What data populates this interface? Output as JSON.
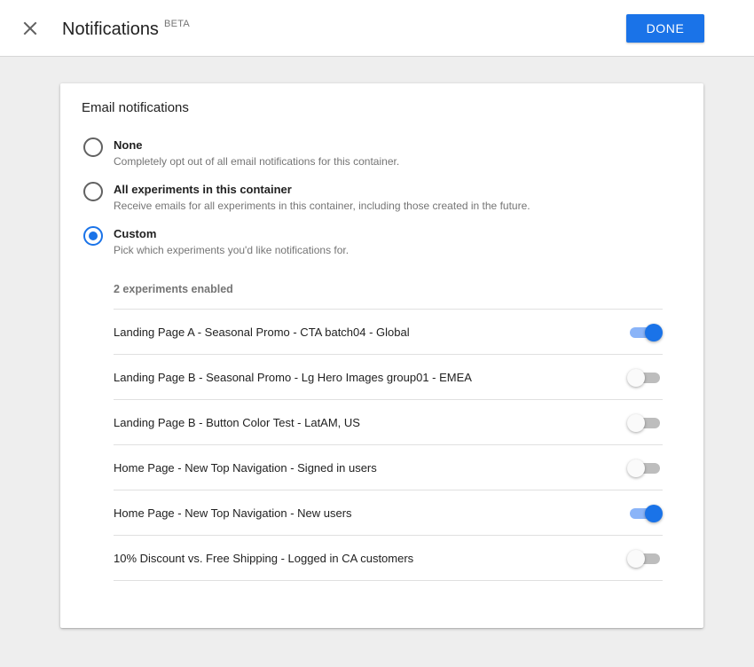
{
  "header": {
    "title": "Notifications",
    "badge": "BETA",
    "done_label": "DONE",
    "close_icon": "close-icon"
  },
  "card": {
    "title": "Email notifications",
    "options": [
      {
        "label": "None",
        "description": "Completely opt out of all email notifications for this container.",
        "selected": false
      },
      {
        "label": "All experiments in this container",
        "description": "Receive emails for all experiments in this container, including those created in the future.",
        "selected": false
      },
      {
        "label": "Custom",
        "description": "Pick which experiments you'd like notifications for.",
        "selected": true
      }
    ],
    "enabled_count": "2 experiments enabled",
    "experiments": [
      {
        "name": "Landing Page A - Seasonal Promo - CTA batch04 - Global",
        "enabled": true
      },
      {
        "name": "Landing Page B - Seasonal Promo - Lg Hero Images group01 - EMEA",
        "enabled": false
      },
      {
        "name": "Landing Page B - Button Color Test - LatAM, US",
        "enabled": false
      },
      {
        "name": "Home Page - New Top Navigation - Signed in users",
        "enabled": false
      },
      {
        "name": "Home Page - New Top Navigation - New users",
        "enabled": true
      },
      {
        "name": "10% Discount vs. Free Shipping - Logged in CA customers",
        "enabled": false
      }
    ]
  },
  "colors": {
    "accent": "#1a73e8",
    "accent_track": "#8ab4f8",
    "background": "#eeeeee"
  }
}
